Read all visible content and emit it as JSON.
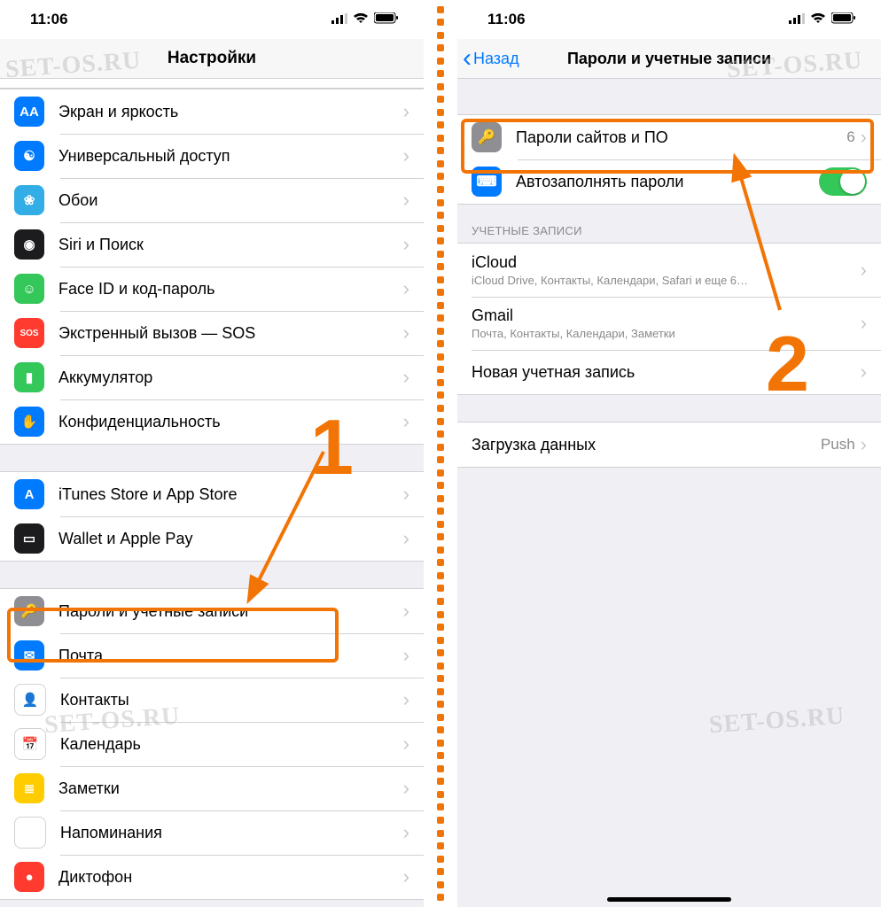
{
  "status": {
    "time": "11:06"
  },
  "watermark": "SET-OS.RU",
  "annotations": {
    "step1": "1",
    "step2": "2"
  },
  "left": {
    "title": "Настройки",
    "groups": [
      {
        "items": [
          {
            "icon": "display-icon",
            "color": "ic-blue",
            "glyph": "AA",
            "label": "Экран и яркость"
          },
          {
            "icon": "accessibility-icon",
            "color": "ic-blue",
            "glyph": "☯",
            "label": "Универсальный доступ"
          },
          {
            "icon": "wallpaper-icon",
            "color": "ic-teal",
            "glyph": "❀",
            "label": "Обои"
          },
          {
            "icon": "siri-icon",
            "color": "ic-black",
            "glyph": "◉",
            "label": "Siri и Поиск"
          },
          {
            "icon": "faceid-icon",
            "color": "ic-green",
            "glyph": "☺",
            "label": "Face ID и код-пароль"
          },
          {
            "icon": "sos-icon",
            "color": "ic-red",
            "glyph": "SOS",
            "label": "Экстренный вызов — SOS"
          },
          {
            "icon": "battery-icon",
            "color": "ic-green",
            "glyph": "▮",
            "label": "Аккумулятор"
          },
          {
            "icon": "privacy-icon",
            "color": "ic-blue",
            "glyph": "✋",
            "label": "Конфиденциальность"
          }
        ]
      },
      {
        "items": [
          {
            "icon": "appstore-icon",
            "color": "ic-blue",
            "glyph": "A",
            "label": "iTunes Store и App Store"
          },
          {
            "icon": "wallet-icon",
            "color": "ic-black",
            "glyph": "▭",
            "label": "Wallet и Apple Pay"
          }
        ]
      },
      {
        "items": [
          {
            "icon": "passwords-icon",
            "color": "ic-gray",
            "glyph": "🔑",
            "label": "Пароли и учетные записи",
            "hl": true
          },
          {
            "icon": "mail-icon",
            "color": "ic-blue",
            "glyph": "✉",
            "label": "Почта"
          },
          {
            "icon": "contacts-icon",
            "color": "ic-white",
            "glyph": "👤",
            "label": "Контакты"
          },
          {
            "icon": "calendar-icon",
            "color": "ic-white",
            "glyph": "📅",
            "label": "Календарь"
          },
          {
            "icon": "notes-icon",
            "color": "ic-yellow",
            "glyph": "≣",
            "label": "Заметки"
          },
          {
            "icon": "reminders-icon",
            "color": "ic-white",
            "glyph": "⋮",
            "label": "Напоминания"
          },
          {
            "icon": "voicememo-icon",
            "color": "ic-red",
            "glyph": "●",
            "label": "Диктофон"
          }
        ]
      }
    ]
  },
  "right": {
    "back": "Назад",
    "title": "Пароли и учетные записи",
    "pwd": {
      "label": "Пароли сайтов и ПО",
      "count": "6"
    },
    "autofill": "Автозаполнять пароли",
    "accounts_hdr": "УЧЕТНЫЕ ЗАПИСИ",
    "accounts": [
      {
        "name": "iCloud",
        "sub": "iCloud Drive, Контакты, Календари, Safari и еще 6…"
      },
      {
        "name": "Gmail",
        "sub": "Почта, Контакты, Календари, Заметки"
      },
      {
        "name": "Новая учетная запись"
      }
    ],
    "fetch": {
      "label": "Загрузка данных",
      "value": "Push"
    }
  }
}
